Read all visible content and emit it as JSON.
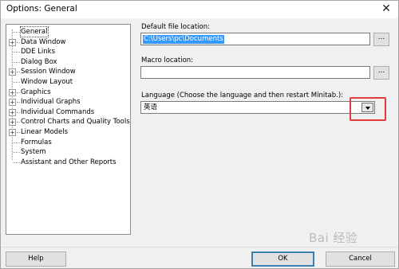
{
  "window": {
    "title": "Options: General",
    "close_glyph": "✕"
  },
  "tree": {
    "items": [
      {
        "label": "General",
        "expandable": false,
        "selected": true
      },
      {
        "label": "Data Window",
        "expandable": true
      },
      {
        "label": "DDE Links",
        "expandable": false
      },
      {
        "label": "Dialog Box",
        "expandable": false
      },
      {
        "label": "Session Window",
        "expandable": true
      },
      {
        "label": "Window Layout",
        "expandable": false
      },
      {
        "label": "Graphics",
        "expandable": true
      },
      {
        "label": "Individual Graphs",
        "expandable": true
      },
      {
        "label": "Individual Commands",
        "expandable": true
      },
      {
        "label": "Control Charts and Quality Tools",
        "expandable": true
      },
      {
        "label": "Linear Models",
        "expandable": true
      },
      {
        "label": "Formulas",
        "expandable": false
      },
      {
        "label": "System",
        "expandable": false
      },
      {
        "label": "Assistant and Other Reports",
        "expandable": false
      }
    ],
    "expander_glyph": "+"
  },
  "form": {
    "default_file_label": "Default file location:",
    "default_file_value": "C:\\Users\\pc\\Documents",
    "macro_label": "Macro location:",
    "macro_value": "",
    "browse_label": "...",
    "language_label": "Language (Choose the language and then restart Minitab.):",
    "language_value": "英语"
  },
  "buttons": {
    "help": "Help",
    "ok": "OK",
    "cancel": "Cancel"
  },
  "watermark": "Bai 经验"
}
